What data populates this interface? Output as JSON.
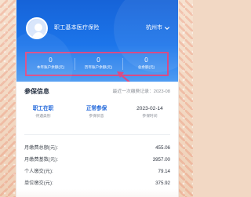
{
  "header": {
    "insurance_name": "职工基本医疗保险",
    "city": "杭州市"
  },
  "stats": [
    {
      "value": "0",
      "label": "本年账户余额(元)"
    },
    {
      "value": "0",
      "label": "历年账户余额(元)"
    },
    {
      "value": "0",
      "label": "总余额(元)"
    }
  ],
  "section": {
    "title": "参保信息",
    "last_record": "最近一次缴费记录：2023-08"
  },
  "status": [
    {
      "value": "职工在职",
      "label": "待遇类别"
    },
    {
      "value": "正常参保",
      "label": "参保状态"
    },
    {
      "value": "2023-02-14",
      "label": "参保时间"
    }
  ],
  "details": [
    {
      "label": "月缴费总额(元):",
      "value": "455.06"
    },
    {
      "label": "月缴费基数(元):",
      "value": "3957.00"
    },
    {
      "label": "个人缴交(元):",
      "value": "79.14"
    },
    {
      "label": "单位缴交(元):",
      "value": "375.92"
    }
  ],
  "colors": {
    "hero_blue": "#1c75ea",
    "highlight_box": "#d94b86",
    "status_blue": "#1f66da",
    "background_peach": "#f2d8c4"
  },
  "icons": {
    "avatar": "user-avatar-icon",
    "dropdown": "chevron-down-icon",
    "annotation_arrow": "annotation-arrow-icon"
  }
}
